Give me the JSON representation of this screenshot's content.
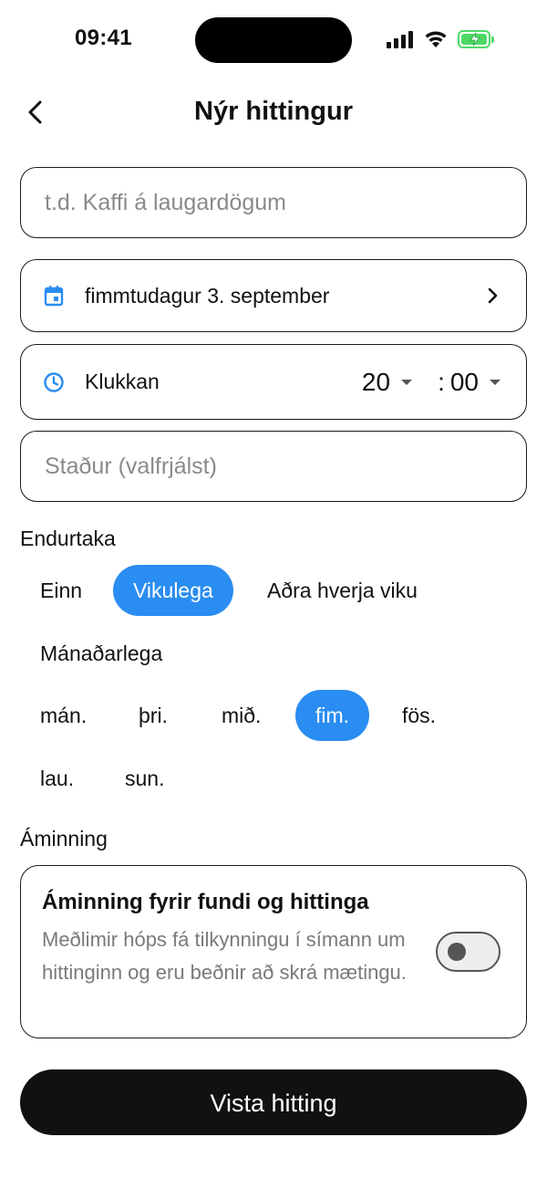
{
  "status_bar": {
    "time": "09:41"
  },
  "header": {
    "title": "Nýr hittingur"
  },
  "name_input": {
    "placeholder": "t.d. Kaffi á laugardögum",
    "value": ""
  },
  "date_field": {
    "value": "fimmtudagur 3. september",
    "icon": "calendar-icon"
  },
  "time_field": {
    "label": "Klukkan",
    "hour": "20",
    "minute": "00",
    "separator": ":",
    "icon": "clock-icon"
  },
  "location_input": {
    "placeholder": "Staður (valfrjálst)",
    "value": ""
  },
  "repeat": {
    "label": "Endurtaka",
    "options": [
      "Einn",
      "Vikulega",
      "Aðra hverja viku",
      "Mánaðarlega"
    ],
    "selected": "Vikulega"
  },
  "weekdays": {
    "options": [
      "mán.",
      "þri.",
      "mið.",
      "fim.",
      "fös.",
      "lau.",
      "sun."
    ],
    "selected": "fim."
  },
  "reminder": {
    "section_label": "Áminning",
    "title": "Áminning fyrir fundi og hittinga",
    "description": "Meðlimir hóps fá tilkynningu í símann um hittinginn og eru beðnir að skrá mætingu.",
    "enabled": false
  },
  "save_button": {
    "label": "Vista hitting"
  },
  "colors": {
    "accent": "#2a8df1",
    "primary_button": "#111111",
    "battery": "#4cd964"
  }
}
